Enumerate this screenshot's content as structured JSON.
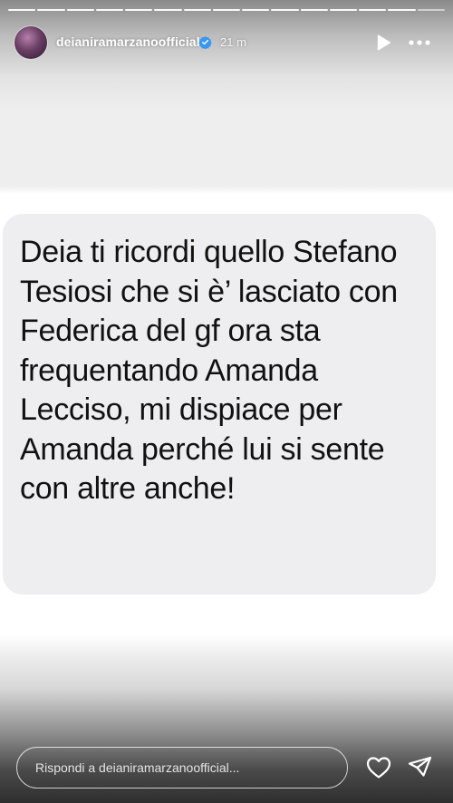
{
  "story": {
    "progress_segments": 15,
    "active_segment": 15
  },
  "header": {
    "username": "deianiramarzanoofficial",
    "time_ago": "21 m",
    "verified_icon": "verified-badge-icon",
    "play_icon": "play-icon",
    "more_icon": "more-options-icon"
  },
  "message": {
    "text": "Deia ti ricordi quello Stefano Tesiosi che si è’ lasciato con Federica del gf ora sta frequentando Amanda Lecciso, mi dispiace per Amanda perché lui si sente con altre anche!"
  },
  "footer": {
    "reply_placeholder": "Rispondi a deianiramarzanoofficial...",
    "like_icon": "heart-icon",
    "send_icon": "paper-plane-icon"
  },
  "colors": {
    "bubble": "#eeeef1",
    "text": "#111111",
    "verified": "#3897f0"
  }
}
